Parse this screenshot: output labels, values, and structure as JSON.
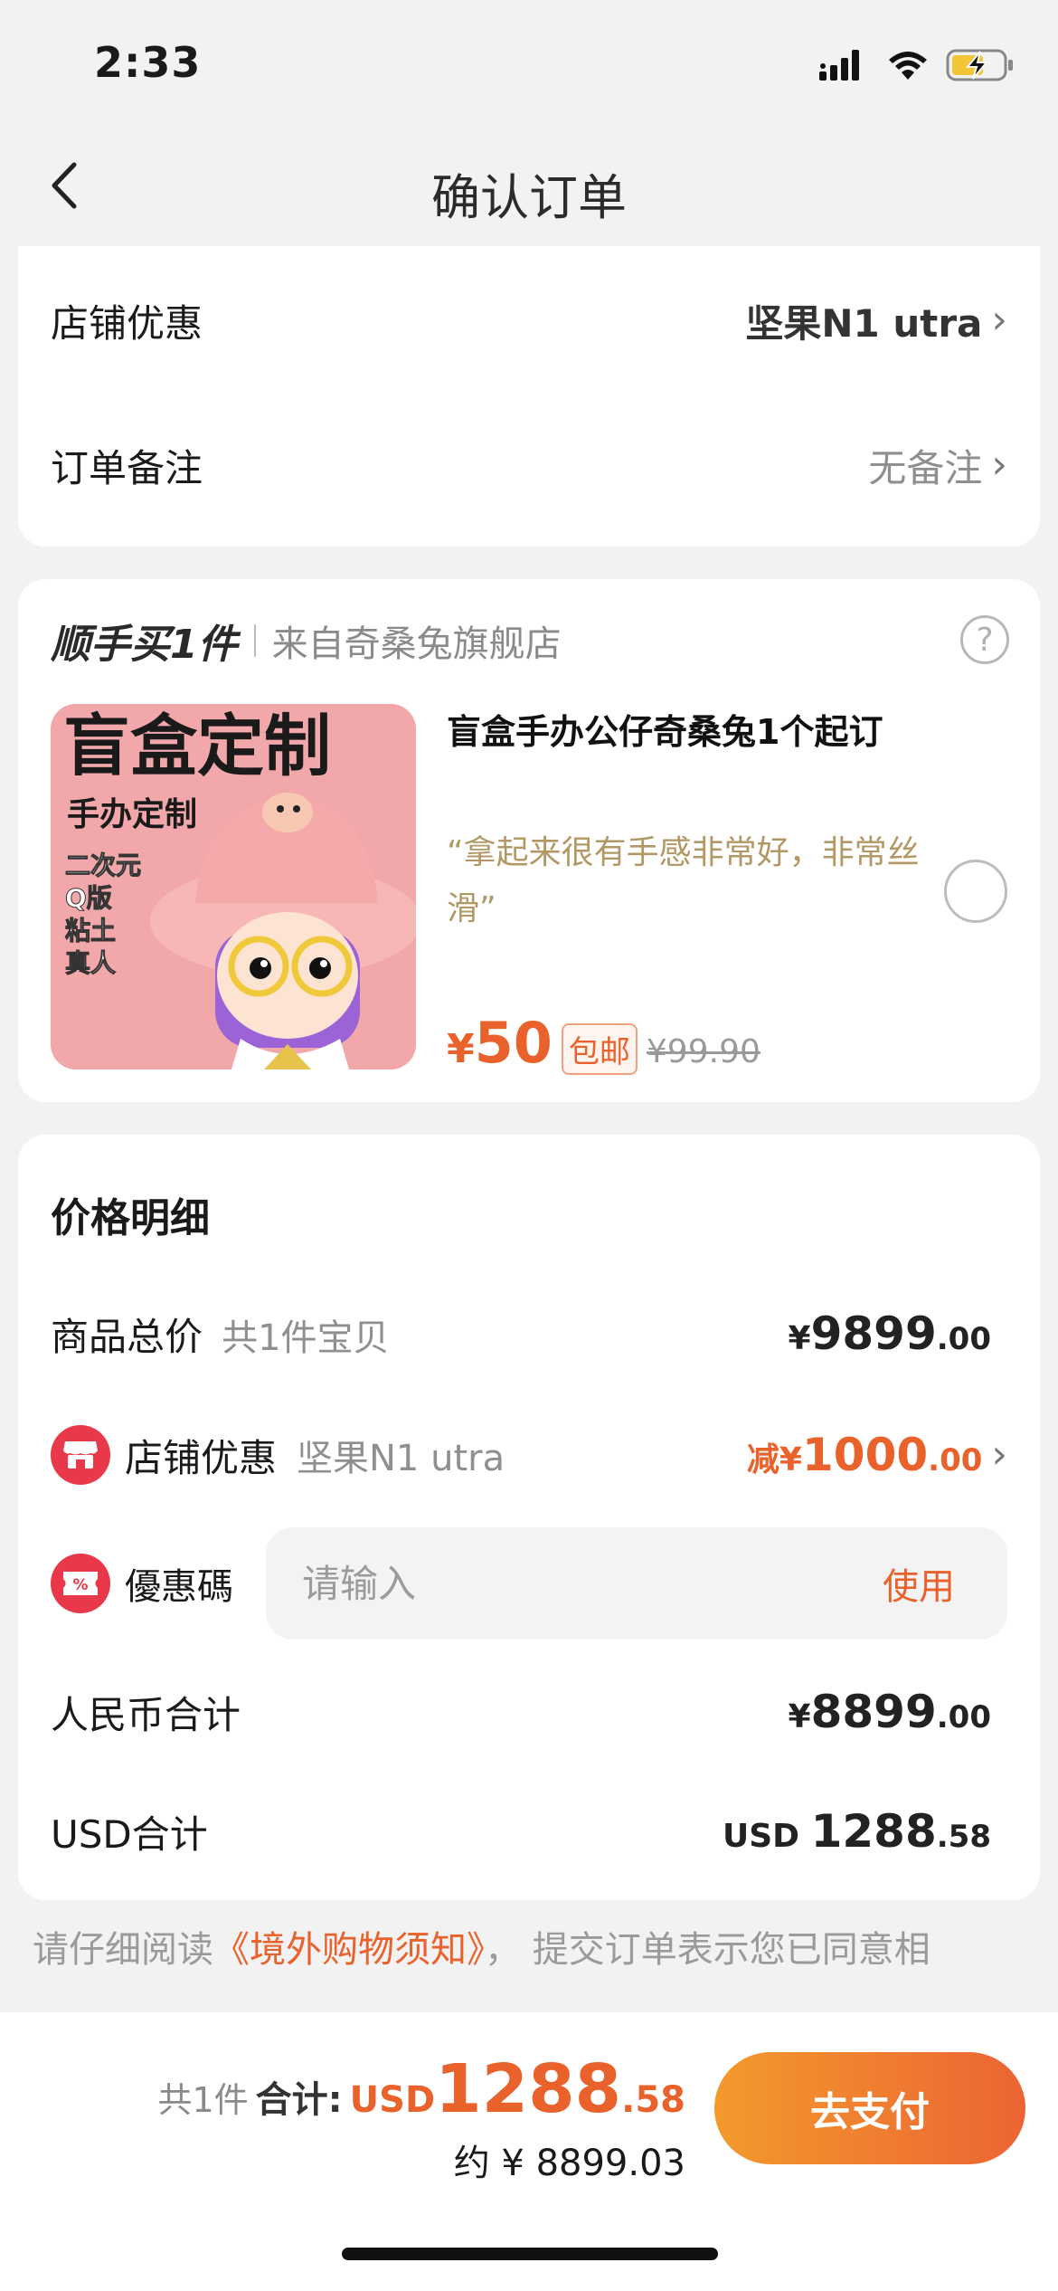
{
  "status_bar": {
    "time": "2:33"
  },
  "nav": {
    "title": "确认订单"
  },
  "order_options": {
    "store_discount": {
      "label": "店铺优惠",
      "value": "坚果N1  utra"
    },
    "order_note": {
      "label": "订单备注",
      "value": "无备注"
    }
  },
  "upsell": {
    "title": "顺手买1件",
    "from": "来自奇桑兔旗舰店",
    "product": {
      "name": "盲盒手办公仔奇桑兔1个起订",
      "review": "“拿起来很有手感非常好，非常丝滑”",
      "price_currency": "¥",
      "price": "50",
      "free_shipping": "包邮",
      "original_price": "¥99.90",
      "image_text": {
        "headline": "盲盒定制",
        "sub": "手办定制",
        "tags": [
          "二次元",
          "Q版",
          "粘土",
          "真人"
        ]
      }
    }
  },
  "price_details": {
    "title": "价格明细",
    "goods_total": {
      "label": "商品总价",
      "note": "共1件宝贝",
      "currency": "¥",
      "int": "9899",
      "dec": ".00"
    },
    "store_discount": {
      "label": "店铺优惠",
      "note": "坚果N1  utra",
      "prefix": "减¥",
      "int": "1000",
      "dec": ".00"
    },
    "coupon": {
      "label": "優惠碼",
      "placeholder": "请输入",
      "button": "使用"
    },
    "rmb_total": {
      "label": "人民币合计",
      "currency": "¥",
      "int": "8899",
      "dec": ".00"
    },
    "usd_total": {
      "label": "USD合计",
      "currency": "USD ",
      "int": "1288",
      "dec": ".58"
    }
  },
  "notice": {
    "prefix": "请仔细阅读",
    "link": "《境外购物须知》",
    "suffix": "，  提交订单表示您已同意相"
  },
  "bottom": {
    "count": "共1件",
    "total_label": "合计:",
    "currency": "USD",
    "int": "1288",
    "dec": ".58",
    "approx": "约 ¥ 8899.03",
    "pay_button": "去支付"
  },
  "colors": {
    "accent": "#e9622c",
    "pay_gradient_start": "#f39a2c",
    "pay_gradient_end": "#ec6433",
    "discount_icon": "#e8384a"
  },
  "icons": [
    "signal-icon",
    "wifi-icon",
    "battery-charging-icon",
    "back-arrow-icon",
    "chevron-right-icon",
    "help-icon",
    "radio-unchecked-icon",
    "store-icon",
    "coupon-icon"
  ]
}
